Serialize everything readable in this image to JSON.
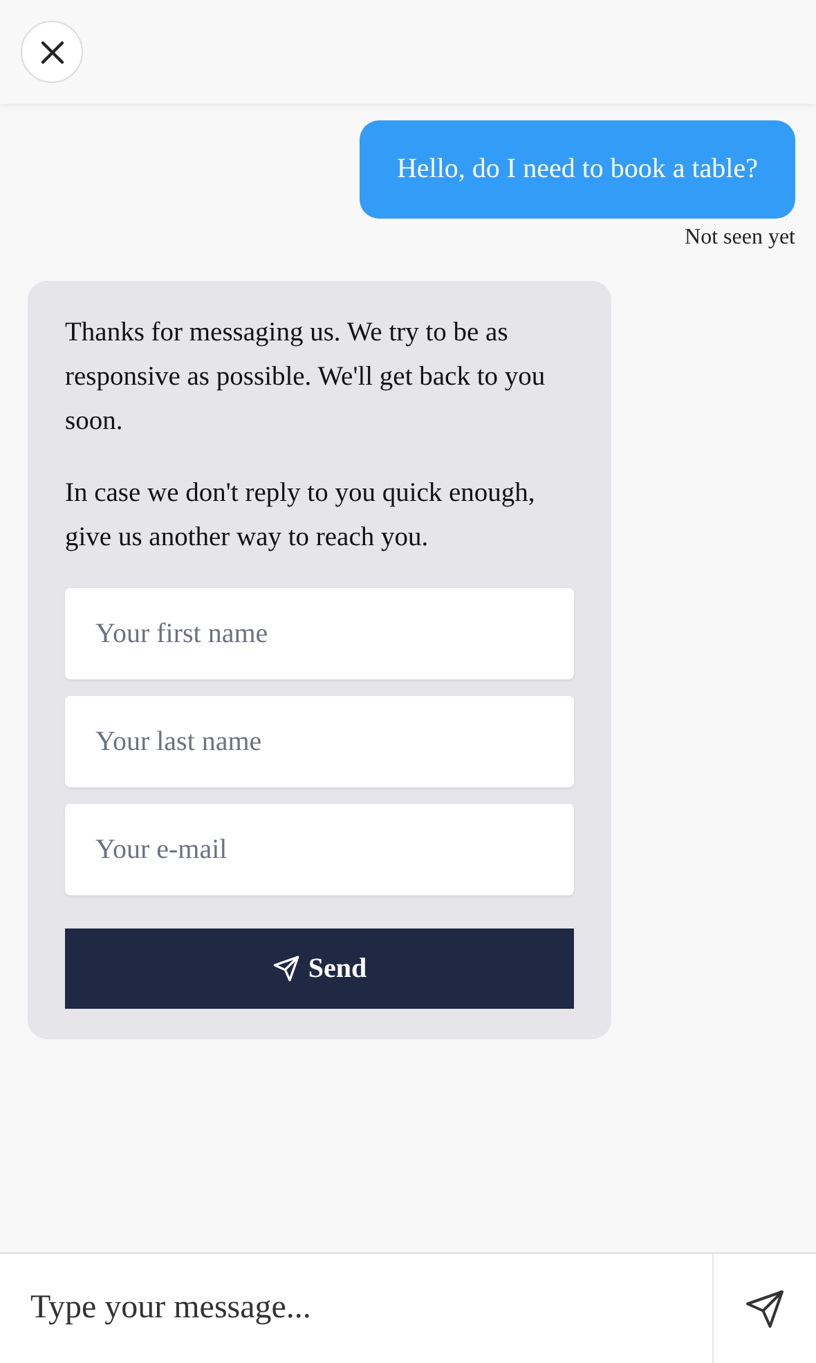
{
  "messages": [
    {
      "kind": "user",
      "text": "Hello, do I need to book a table?",
      "status": "Not seen yet"
    },
    {
      "kind": "bot",
      "paragraphs": [
        "Thanks for messaging us. We try to be as responsive as possible. We'll get back to you soon.",
        "In case we don't reply to you quick enough, give us another way to reach you."
      ],
      "fields": [
        {
          "placeholder": "Your first name"
        },
        {
          "placeholder": "Your last name"
        },
        {
          "placeholder": "Your e-mail"
        }
      ],
      "button": "Send"
    }
  ],
  "composer": {
    "placeholder": "Type your message..."
  }
}
